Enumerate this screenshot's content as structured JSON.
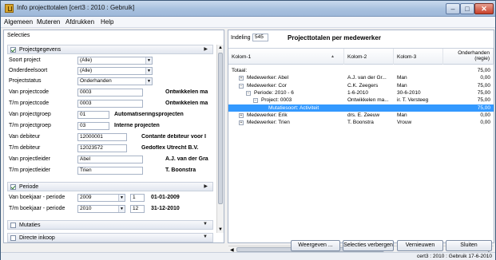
{
  "window": {
    "title": "Info projecttotalen  [cert3 : 2010 : Gebruik]",
    "min_glyph": "–",
    "max_glyph": "□",
    "close_glyph": "✕"
  },
  "menu": [
    "Algemeen",
    "Muteren",
    "Afdrukken",
    "Help"
  ],
  "left": {
    "title": "Selecties",
    "sections": [
      {
        "label": "Projectgegevens",
        "checked": true
      },
      {
        "label": "Periode",
        "checked": true
      },
      {
        "label": "Mutaties",
        "checked": false
      },
      {
        "label": "Directe inkoop",
        "checked": false
      }
    ],
    "fields": [
      {
        "label": "Soort project",
        "value": "(Alle)",
        "desc": ""
      },
      {
        "label": "Onderdeelsoort",
        "value": "(Alle)",
        "desc": ""
      },
      {
        "label": "Projectstatus",
        "value": "Onderhanden",
        "desc": ""
      },
      {
        "label": "Van projectcode",
        "value": "0003",
        "desc": "Ontwikkelen ma"
      },
      {
        "label": "T/m projectcode",
        "value": "0003",
        "desc": "Ontwikkelen ma"
      },
      {
        "label": "Van projectgroep",
        "value": "01",
        "desc": "Automatiseringsprojecten"
      },
      {
        "label": "T/m projectgroep",
        "value": "03",
        "desc": "Interne projecten"
      },
      {
        "label": "Van debiteur",
        "value": "12000001",
        "desc": "Contante debiteur voor I"
      },
      {
        "label": "T/m debiteur",
        "value": "12023572",
        "desc": "Gedoflex Utrecht B.V."
      },
      {
        "label": "Van projectleider",
        "value": "Abel",
        "desc": "A.J. van der Gra"
      },
      {
        "label": "T/m projectleider",
        "value": "Trien",
        "desc": "T. Boonstra"
      }
    ],
    "periods": [
      {
        "label": "Van boekjaar - periode",
        "year": "2009",
        "period": "1",
        "date": "01-01-2009"
      },
      {
        "label": "T/m boekjaar - periode",
        "year": "2010",
        "period": "12",
        "date": "31-12-2010"
      }
    ]
  },
  "right": {
    "indeling_label": "Indeling",
    "indeling_value": "545",
    "title": "Projecttotalen per medewerker",
    "columns": [
      "Kolom-1",
      "Kolom-2",
      "Kolom-3",
      "Onderhanden\n(regie)"
    ],
    "rows": [
      {
        "indent": 0,
        "toggle": "",
        "c1": "Totaal:",
        "c2": "",
        "c3": "",
        "c4": "75,00",
        "selected": false
      },
      {
        "indent": 1,
        "toggle": "+",
        "c1": "Medewerker: Abel",
        "c2": "A.J. van der Gr...",
        "c3": "Man",
        "c4": "0,00",
        "selected": false
      },
      {
        "indent": 1,
        "toggle": "−",
        "c1": "Medewerker: Cor",
        "c2": "C.K. Zeegers",
        "c3": "Man",
        "c4": "75,00",
        "selected": false
      },
      {
        "indent": 2,
        "toggle": "−",
        "c1": "Periode: 2010 - 6",
        "c2": "1-6-2010",
        "c3": "30-6-2010",
        "c4": "75,00",
        "selected": false
      },
      {
        "indent": 3,
        "toggle": "−",
        "c1": "Project: 0003",
        "c2": "Ontwikkelen ma...",
        "c3": "ir. T. Versteeg",
        "c4": "75,00",
        "selected": false
      },
      {
        "indent": 4,
        "toggle": "",
        "c1": "Mutatiesoort: Activiteit",
        "c2": "",
        "c3": "",
        "c4": "75,00",
        "selected": true
      },
      {
        "indent": 1,
        "toggle": "+",
        "c1": "Medewerker: Erik",
        "c2": "drs. E. Zeeuw",
        "c3": "Man",
        "c4": "0,00",
        "selected": false
      },
      {
        "indent": 1,
        "toggle": "+",
        "c1": "Medewerker: Trien",
        "c2": "T. Boonstra",
        "c3": "Vrouw",
        "c4": "0,00",
        "selected": false
      }
    ]
  },
  "buttons": {
    "weergeven": "Weergeven ...",
    "selecties_verbergen": "Selecties verbergen",
    "vernieuwen": "Vernieuwen",
    "sluiten": "Sluiten"
  },
  "status": "cert3 : 2010 : Gebruik   17-6-2010",
  "glyphs": {
    "expand": "▶",
    "collapse": "▼",
    "dropdown": "▼",
    "scroll_up": "▲",
    "scroll_down": "▼",
    "scroll_left": "◀",
    "scroll_right": "▶",
    "sort_asc": "▲",
    "grip": "III"
  },
  "colors": {
    "selected_row": "#3399ff",
    "title_bar": "#a8c1df"
  }
}
